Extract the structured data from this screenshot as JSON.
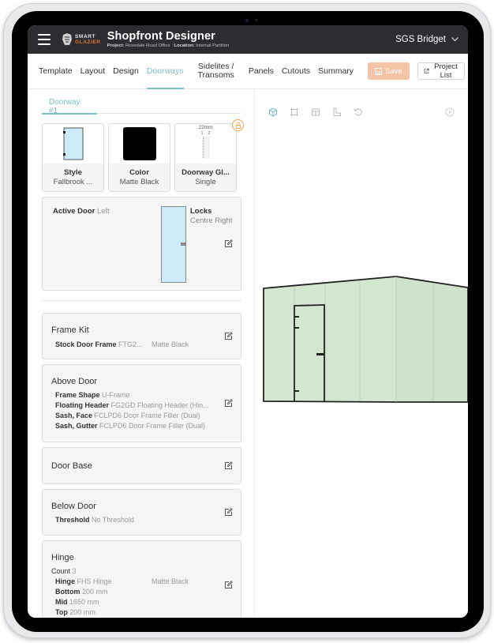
{
  "app": {
    "title": "Shopfront Designer",
    "logo_line1": "SMART",
    "logo_line2": "GLAZIER",
    "project_label": "Project:",
    "project_value": "Rosedale Road Office",
    "location_label": "Location:",
    "location_value": "Internal Partition",
    "user_name": "SGS Bridget",
    "icons": {
      "menu": "hamburger-icon",
      "user_menu": "chevron-down-icon"
    }
  },
  "nav": {
    "tabs": [
      {
        "label": "Template",
        "active": false
      },
      {
        "label": "Layout",
        "active": false
      },
      {
        "label": "Design",
        "active": false
      },
      {
        "label": "Doorways",
        "active": true
      },
      {
        "label_line1": "Sidelites /",
        "label_line2": "Transoms",
        "active": false
      },
      {
        "label": "Panels",
        "active": false
      },
      {
        "label": "Cutouts",
        "active": false
      },
      {
        "label": "Summary",
        "active": false
      }
    ],
    "save_label": "Save",
    "save_color": "#f5c3a6",
    "project_list_label": "Project List",
    "accent_color": "#7dbfc6"
  },
  "doorway": {
    "sub_tab": "Doorway #1",
    "options": [
      {
        "title": "Style",
        "value": "Fallbrook ...",
        "icon": "door-style-icon"
      },
      {
        "title": "Color",
        "value": "Matte Black",
        "swatch": "#000000"
      },
      {
        "title": "Doorway Gl...",
        "value": "Single",
        "glass_thickness": "22mm",
        "glass_labels": [
          "1",
          "2"
        ],
        "locked": true
      }
    ],
    "active_door": {
      "label": "Active Door",
      "value": "Left"
    },
    "locks": {
      "label": "Locks",
      "value": "Centre Right"
    },
    "sections": [
      {
        "title": "Frame Kit",
        "rows": [
          {
            "label": "Stock Door Frame",
            "value": "FTG2...",
            "color": "Matte Black"
          }
        ]
      },
      {
        "title": "Above Door",
        "rows": [
          {
            "label": "Frame Shape",
            "value": "U-Frame"
          },
          {
            "label": "Floating Header",
            "value": "FG2GD Floating Header (Hin..."
          },
          {
            "label": "Sash, Face",
            "value": "FCLPD6 Door Frame Filler (Dual)"
          },
          {
            "label": "Sash, Gutter",
            "value": "FCLPD6 Door Frame Filler (Dual)"
          }
        ]
      },
      {
        "title": "Door Base",
        "rows": []
      },
      {
        "title": "Below Door",
        "rows": [
          {
            "label": "Threshold",
            "value": "No Threshold"
          }
        ]
      },
      {
        "title": "Hinge",
        "count_label": "Count",
        "count_value": "3",
        "rows": [
          {
            "label": "Hinge",
            "value": "FHS Hinge",
            "color": "Matte Black"
          },
          {
            "label": "Bottom",
            "value": "200 mm"
          },
          {
            "label": "Mid",
            "value": "1650 mm"
          },
          {
            "label": "Top",
            "value": "200 mm"
          }
        ]
      }
    ]
  },
  "viewer": {
    "tools": [
      "3d-view-icon",
      "front-view-icon",
      "elevation-view-icon",
      "plan-view-icon",
      "reset-view-icon"
    ],
    "play": "play-icon",
    "panel_color": "#d3e6cf",
    "frame_color": "#222222"
  }
}
